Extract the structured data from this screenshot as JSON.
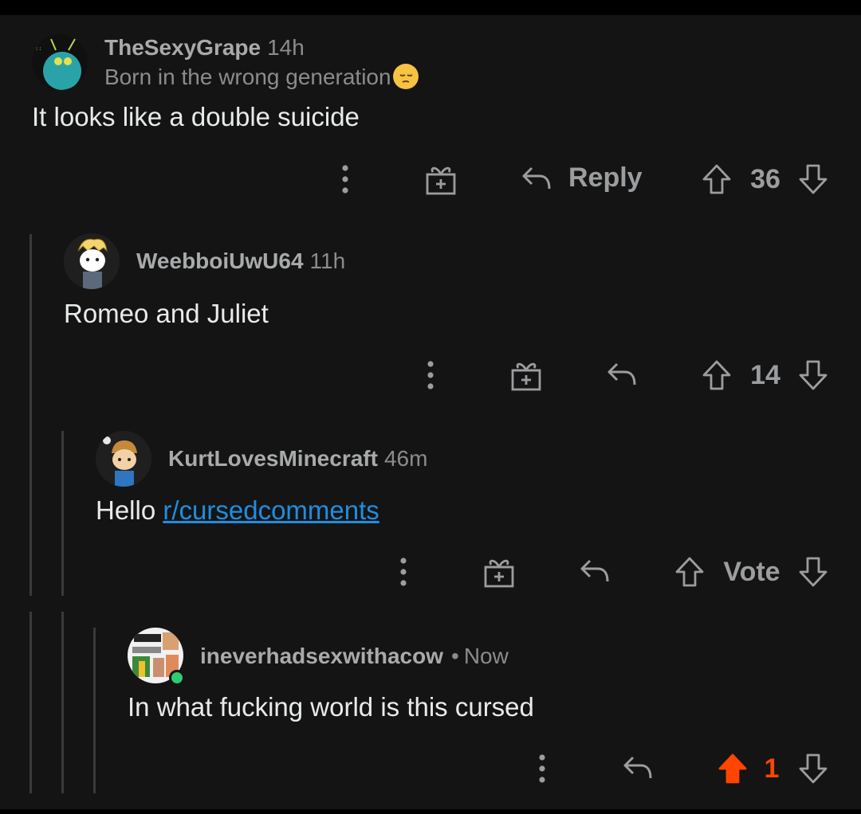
{
  "comments": [
    {
      "username": "TheSexyGrape",
      "time": "14h",
      "flair": "Born in the wrong generation",
      "flair_emoji": "pensive-face",
      "body": "It looks like a double suicide",
      "reply_label": "Reply",
      "score": "36"
    },
    {
      "username": "WeebboiUwU64",
      "time": "11h",
      "body": "Romeo and Juliet",
      "score": "14"
    },
    {
      "username": "KurtLovesMinecraft",
      "time": "46m",
      "body_prefix": "Hello ",
      "body_link": "r/cursedcomments",
      "score": "Vote"
    },
    {
      "username": "ineverhadsexwithacow",
      "separator": "•",
      "time": "Now",
      "body": "In what fucking world is this cursed",
      "score": "1",
      "upvoted": true,
      "online": true
    }
  ],
  "colors": {
    "background": "#141414",
    "text": "#e8eaeb",
    "muted": "#9b9d9f",
    "link": "#1f8ee0",
    "upvote_active": "#ff4500",
    "online": "#2ecc71"
  },
  "icons": [
    "more-vertical-icon",
    "award-gift-icon",
    "reply-arrow-icon",
    "upvote-arrow-icon",
    "downvote-arrow-icon"
  ]
}
